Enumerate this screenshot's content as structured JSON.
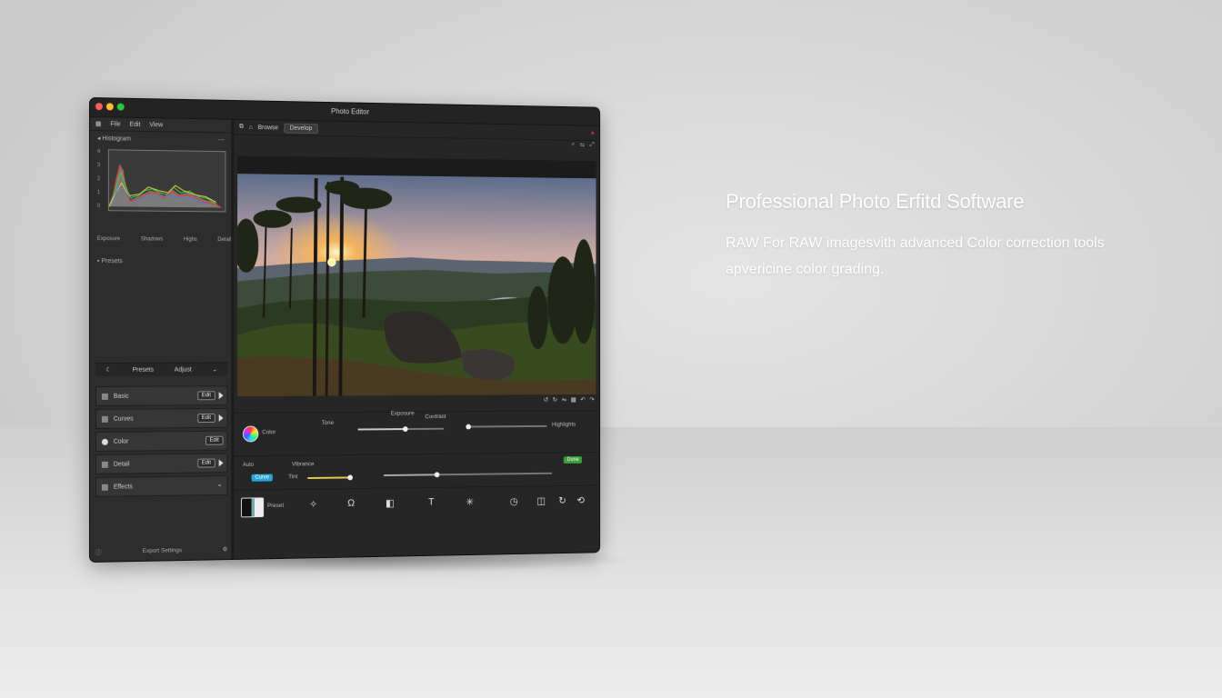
{
  "window": {
    "title": "Photo Editor",
    "menu": [
      "File",
      "Edit",
      "View"
    ],
    "histogram": {
      "header_left": "Histogram",
      "header_right": "",
      "y_ticks": [
        "4",
        "3",
        "2",
        "1",
        "0"
      ],
      "x_ticks": [
        "Exposure",
        "Shadows",
        "Highs",
        "Detail"
      ]
    },
    "presets_label": "Presets",
    "panel_tabs": [
      "Presets",
      "Adjust"
    ],
    "panels": [
      {
        "label": "Basic",
        "control": "Edit"
      },
      {
        "label": "Curves",
        "control": "Edit"
      },
      {
        "label": "Color",
        "control": "Edit"
      },
      {
        "label": "Detail",
        "control": "Edit"
      },
      {
        "label": "Effects",
        "control": ""
      }
    ],
    "footer_label": "Export Settings",
    "toolbar": {
      "first": "Browse",
      "tab": "Develop"
    },
    "adjust": {
      "wheel_label": "Color",
      "top_label": "Tone",
      "slider1_label": "Exposure",
      "slider2_label": "Contrast",
      "highlight_label": "Highlights",
      "accent_chip": "Auto",
      "blue_chip": "Curve",
      "green_chip": "Done",
      "tint_label": "Tint",
      "vibrance_label": "Vibrance",
      "swatch_label": "Preset"
    }
  },
  "marketing": {
    "headline": "Professional Photo Erfitd Software",
    "description": "RAW For RAW imagesvith advanced Color correction tools apvericine color grading."
  },
  "colors": {
    "accent_yellow": "#e6c94a",
    "accent_green": "#3c9d3c",
    "accent_blue": "#2aa7d6"
  }
}
